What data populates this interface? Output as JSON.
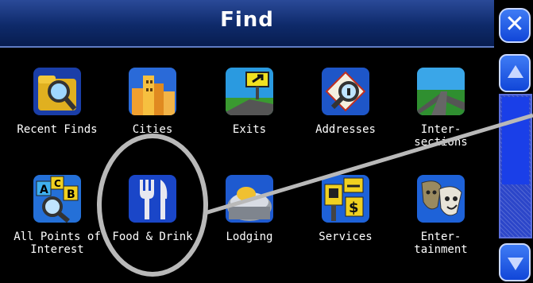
{
  "header": {
    "title": "Find"
  },
  "controls": {
    "close_label": "✕"
  },
  "items": [
    {
      "label": "Recent Finds",
      "icon": "recent-finds-icon"
    },
    {
      "label": "Cities",
      "icon": "cities-icon"
    },
    {
      "label": "Exits",
      "icon": "exits-icon"
    },
    {
      "label": "Addresses",
      "icon": "addresses-icon"
    },
    {
      "label": "Inter-\nsections",
      "icon": "intersections-icon"
    },
    {
      "label": "All Points of\nInterest",
      "icon": "all-poi-icon"
    },
    {
      "label": "Food & Drink",
      "icon": "food-drink-icon"
    },
    {
      "label": "Lodging",
      "icon": "lodging-icon"
    },
    {
      "label": "Services",
      "icon": "services-icon"
    },
    {
      "label": "Enter-\ntainment",
      "icon": "entertainment-icon"
    }
  ],
  "colors": {
    "title_bar": "#0e2a6a",
    "button": "#1146d8",
    "highlight_ring": "#b9b9b9"
  }
}
